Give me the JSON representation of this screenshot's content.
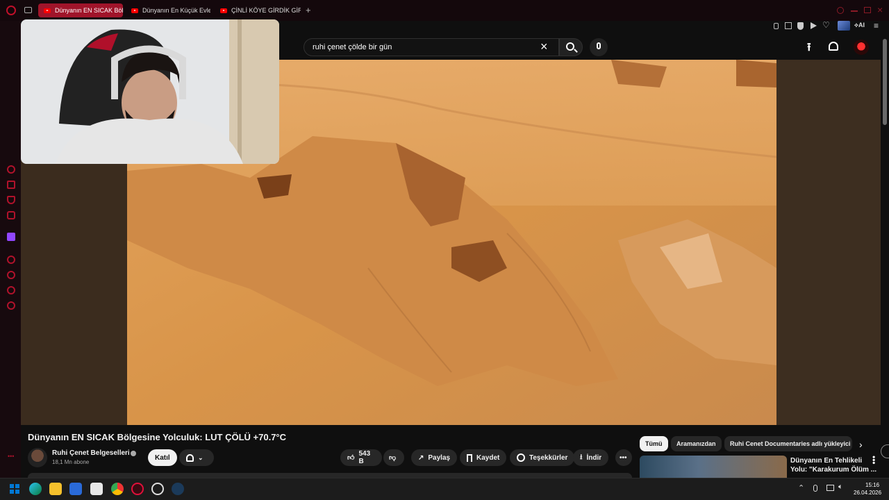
{
  "browser": {
    "tabs": [
      {
        "label": "Dünyanın EN SICAK Bölge",
        "active": true
      },
      {
        "label": "Dünyanın En Küçük Evleri",
        "active": false
      },
      {
        "label": "ÇİNLİ KÖYE GİRDİK GİRME",
        "active": false
      }
    ],
    "ai_label": "AI"
  },
  "search": {
    "query": "ruhi çenet çölde bir gün"
  },
  "video": {
    "title": "Dünyanın EN SICAK Bölgesine Yolculuk: LUT ÇÖLÜ +70.7°C",
    "channel_name": "Ruhi Çenet Belgeselleri",
    "subscribers": "18,1 Mn abone",
    "join_label": "Katıl",
    "like_count": "543 B",
    "share_label": "Paylaş",
    "save_label": "Kaydet",
    "thanks_label": "Teşekkürler",
    "download_label": "İndir"
  },
  "chips": [
    "Tümü",
    "Aramanızdan",
    "Ruhi Cenet Documentaries adlı yükleyici"
  ],
  "recommendation": {
    "title_line1": "Dünyanın En Tehlikeli",
    "title_line2": "Yolu: \"Karakurum Ölüm ..."
  },
  "clock": {
    "time": "15:16",
    "date": "26.04.2026"
  },
  "colors": {
    "accent": "#a0142a",
    "youtube_red": "#ff0000"
  }
}
